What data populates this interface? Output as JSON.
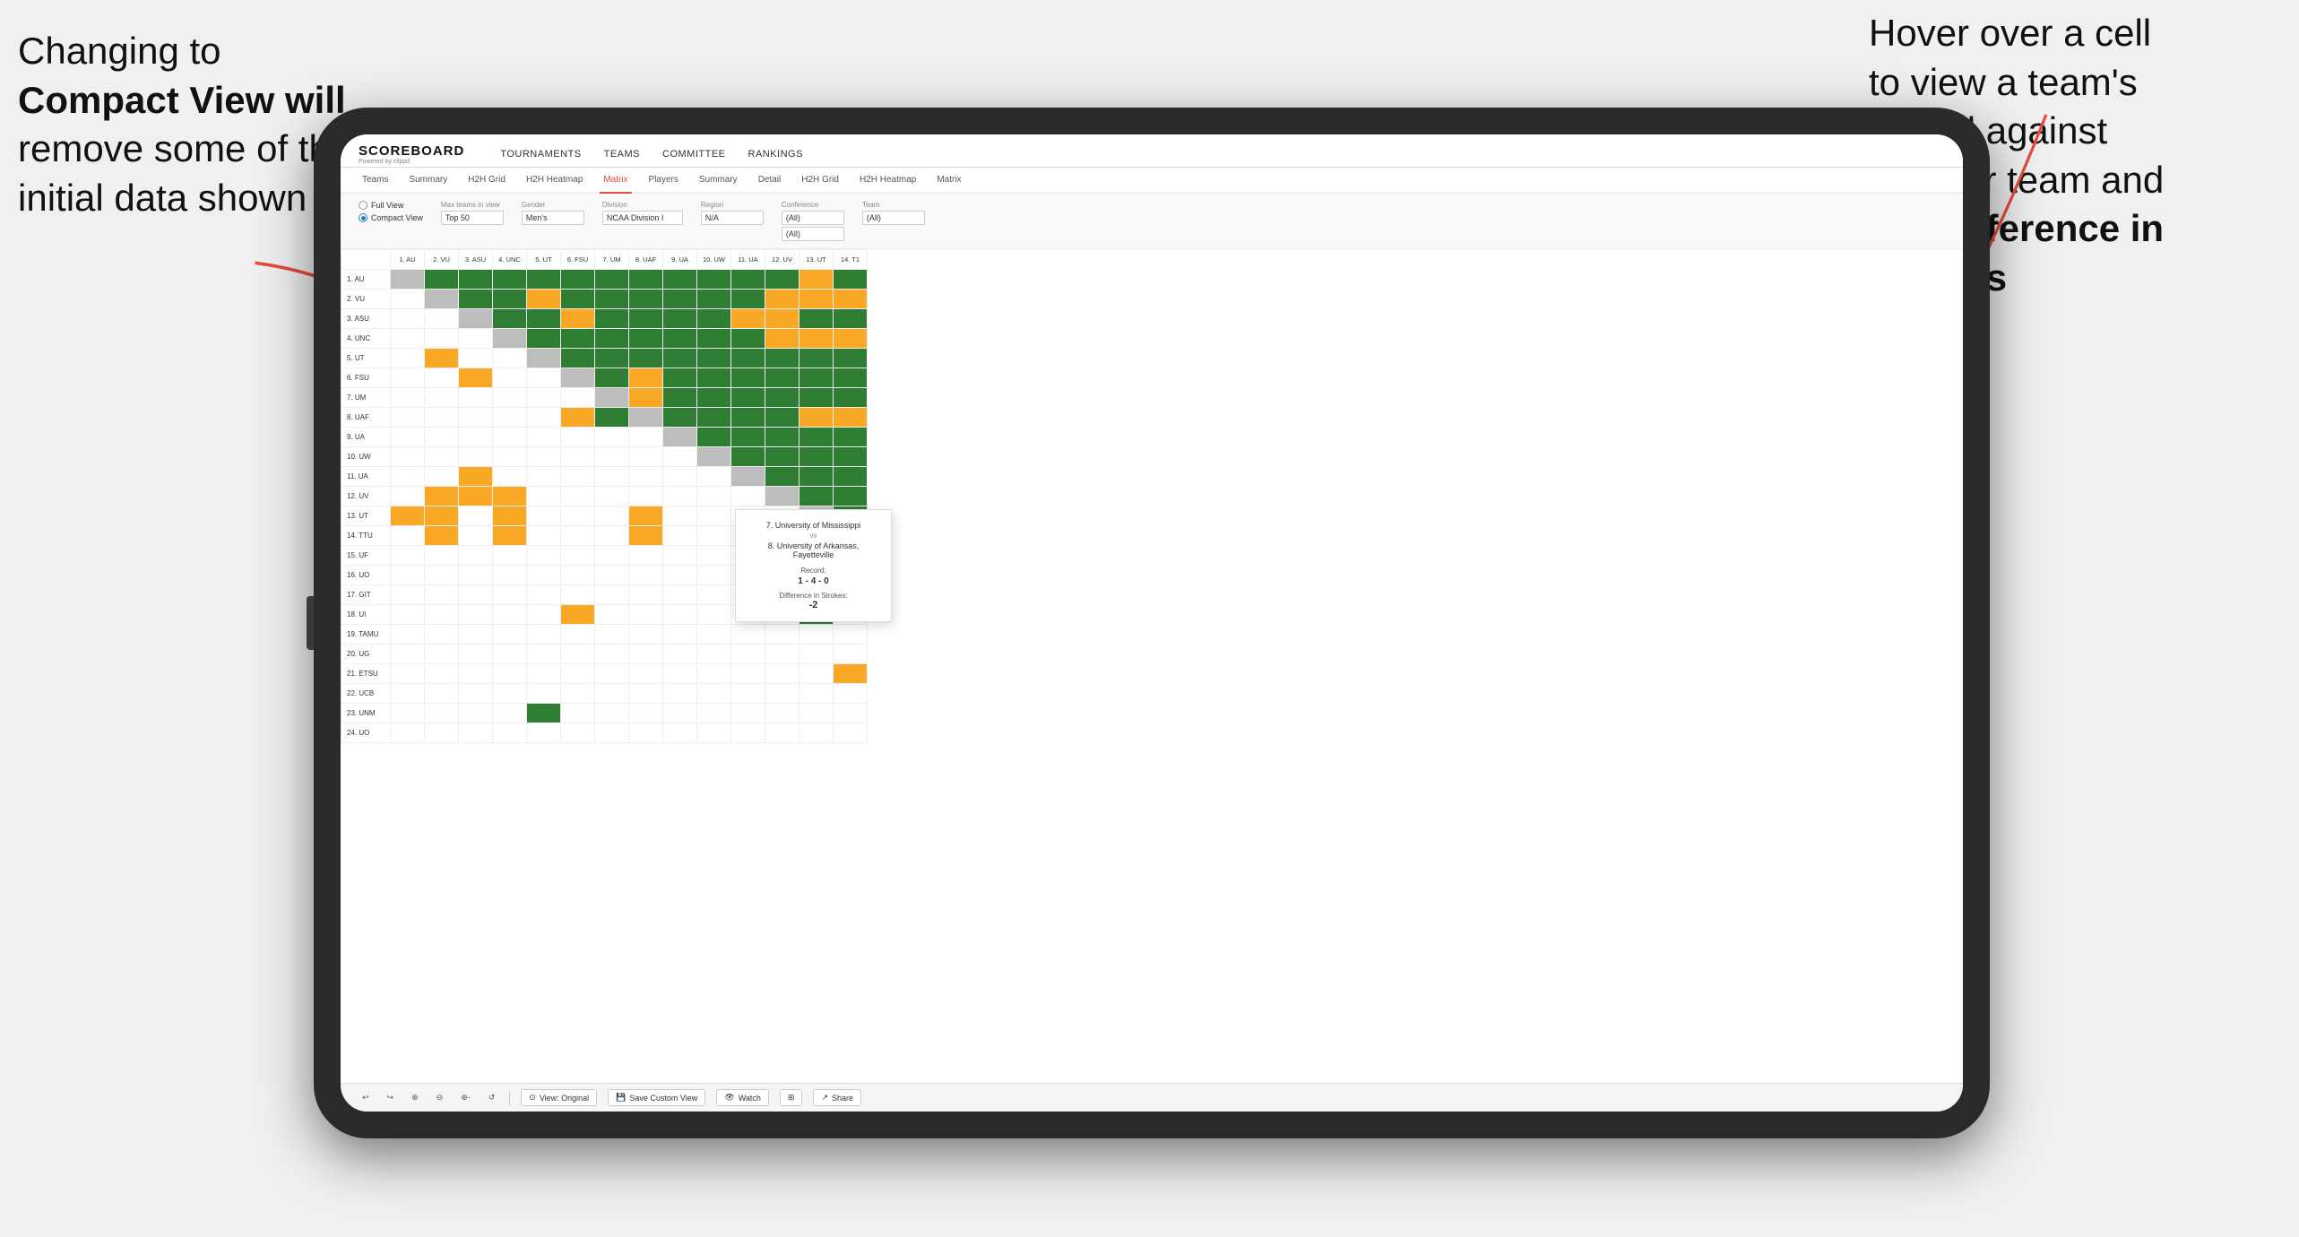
{
  "annotations": {
    "left": {
      "line1": "Changing to",
      "line2bold": "Compact View will",
      "line3": "remove some of the",
      "line4": "initial data shown"
    },
    "right": {
      "line1": "Hover over a cell",
      "line2": "to view a team's",
      "line3": "record against",
      "line4": "another team and",
      "line5bold": "the Difference in",
      "line6bold": "Strokes"
    }
  },
  "scoreboard": {
    "title": "SCOREBOARD",
    "subtitle": "Powered by clippd"
  },
  "nav": {
    "items": [
      "TOURNAMENTS",
      "TEAMS",
      "COMMITTEE",
      "RANKINGS"
    ]
  },
  "subnav": {
    "groups": [
      {
        "label": "Teams",
        "active": false
      },
      {
        "label": "Summary",
        "active": false
      },
      {
        "label": "H2H Grid",
        "active": false
      },
      {
        "label": "H2H Heatmap",
        "active": false
      },
      {
        "label": "Matrix",
        "active": true
      },
      {
        "label": "Players",
        "active": false
      },
      {
        "label": "Summary",
        "active": false
      },
      {
        "label": "Detail",
        "active": false
      },
      {
        "label": "H2H Grid",
        "active": false
      },
      {
        "label": "H2H Heatmap",
        "active": false
      },
      {
        "label": "Matrix",
        "active": false
      }
    ]
  },
  "viewOptions": {
    "fullView": "Full View",
    "compactView": "Compact View",
    "selectedView": "compact"
  },
  "filters": {
    "maxTeams": {
      "label": "Max teams in view",
      "value": "Top 50"
    },
    "gender": {
      "label": "Gender",
      "value": "Men's"
    },
    "division": {
      "label": "Division",
      "value": "NCAA Division I"
    },
    "region": {
      "label": "Region",
      "value": "N/A"
    },
    "conference": {
      "label": "Conference",
      "values": [
        "(All)",
        "(All)",
        "(All)"
      ]
    },
    "team": {
      "label": "Team",
      "value": "(All)"
    }
  },
  "colHeaders": [
    "1. AU",
    "2. VU",
    "3. ASU",
    "4. UNC",
    "5. UT",
    "6. FSU",
    "7. UM",
    "8. UAF",
    "9. UA",
    "10. UW",
    "11. UA",
    "12. UV",
    "13. UT",
    "14. T1"
  ],
  "rows": [
    {
      "label": "1. AU",
      "cells": [
        "x",
        "g",
        "g",
        "g",
        "g",
        "g",
        "g",
        "g",
        "g",
        "g",
        "g",
        "g",
        "y",
        "g"
      ]
    },
    {
      "label": "2. VU",
      "cells": [
        "w",
        "x",
        "g",
        "g",
        "y",
        "g",
        "g",
        "g",
        "g",
        "g",
        "g",
        "y",
        "y",
        "y"
      ]
    },
    {
      "label": "3. ASU",
      "cells": [
        "w",
        "w",
        "x",
        "g",
        "g",
        "y",
        "g",
        "g",
        "g",
        "g",
        "y",
        "y",
        "g",
        "g"
      ]
    },
    {
      "label": "4. UNC",
      "cells": [
        "w",
        "w",
        "w",
        "x",
        "g",
        "g",
        "g",
        "g",
        "g",
        "g",
        "g",
        "y",
        "y",
        "y"
      ]
    },
    {
      "label": "5. UT",
      "cells": [
        "w",
        "y",
        "w",
        "w",
        "x",
        "g",
        "g",
        "g",
        "g",
        "g",
        "g",
        "g",
        "g",
        "g"
      ]
    },
    {
      "label": "6. FSU",
      "cells": [
        "w",
        "w",
        "y",
        "w",
        "w",
        "x",
        "g",
        "y",
        "g",
        "g",
        "g",
        "g",
        "g",
        "g"
      ]
    },
    {
      "label": "7. UM",
      "cells": [
        "w",
        "w",
        "w",
        "w",
        "w",
        "w",
        "x",
        "y",
        "g",
        "g",
        "g",
        "g",
        "g",
        "g"
      ]
    },
    {
      "label": "8. UAF",
      "cells": [
        "w",
        "w",
        "w",
        "w",
        "w",
        "y",
        "g",
        "x",
        "g",
        "g",
        "g",
        "g",
        "y",
        "y"
      ]
    },
    {
      "label": "9. UA",
      "cells": [
        "w",
        "w",
        "w",
        "w",
        "w",
        "w",
        "w",
        "w",
        "x",
        "g",
        "g",
        "g",
        "g",
        "g"
      ]
    },
    {
      "label": "10. UW",
      "cells": [
        "w",
        "w",
        "w",
        "w",
        "w",
        "w",
        "w",
        "w",
        "w",
        "x",
        "g",
        "g",
        "g",
        "g"
      ]
    },
    {
      "label": "11. UA",
      "cells": [
        "w",
        "w",
        "y",
        "w",
        "w",
        "w",
        "w",
        "w",
        "w",
        "w",
        "x",
        "g",
        "g",
        "g"
      ]
    },
    {
      "label": "12. UV",
      "cells": [
        "w",
        "y",
        "y",
        "y",
        "w",
        "w",
        "w",
        "w",
        "w",
        "w",
        "w",
        "x",
        "g",
        "g"
      ]
    },
    {
      "label": "13. UT",
      "cells": [
        "y",
        "y",
        "w",
        "y",
        "w",
        "w",
        "w",
        "y",
        "w",
        "w",
        "w",
        "w",
        "x",
        "g"
      ]
    },
    {
      "label": "14. TTU",
      "cells": [
        "w",
        "y",
        "w",
        "y",
        "w",
        "w",
        "w",
        "y",
        "w",
        "w",
        "w",
        "w",
        "w",
        "x"
      ]
    },
    {
      "label": "15. UF",
      "cells": [
        "w",
        "w",
        "w",
        "w",
        "w",
        "w",
        "w",
        "w",
        "w",
        "w",
        "w",
        "w",
        "w",
        "w"
      ]
    },
    {
      "label": "16. UO",
      "cells": [
        "w",
        "w",
        "w",
        "w",
        "w",
        "w",
        "w",
        "w",
        "w",
        "w",
        "w",
        "w",
        "y",
        "w"
      ]
    },
    {
      "label": "17. GIT",
      "cells": [
        "w",
        "w",
        "w",
        "w",
        "w",
        "w",
        "w",
        "w",
        "w",
        "w",
        "w",
        "y",
        "w",
        "w"
      ]
    },
    {
      "label": "18. UI",
      "cells": [
        "w",
        "w",
        "w",
        "w",
        "w",
        "y",
        "w",
        "w",
        "w",
        "w",
        "w",
        "w",
        "g",
        "w"
      ]
    },
    {
      "label": "19. TAMU",
      "cells": [
        "w",
        "w",
        "w",
        "w",
        "w",
        "w",
        "w",
        "w",
        "w",
        "w",
        "w",
        "w",
        "w",
        "w"
      ]
    },
    {
      "label": "20. UG",
      "cells": [
        "w",
        "w",
        "w",
        "w",
        "w",
        "w",
        "w",
        "w",
        "w",
        "w",
        "w",
        "w",
        "w",
        "w"
      ]
    },
    {
      "label": "21. ETSU",
      "cells": [
        "w",
        "w",
        "w",
        "w",
        "w",
        "w",
        "w",
        "w",
        "w",
        "w",
        "w",
        "w",
        "w",
        "y"
      ]
    },
    {
      "label": "22. UCB",
      "cells": [
        "w",
        "w",
        "w",
        "w",
        "w",
        "w",
        "w",
        "w",
        "w",
        "w",
        "w",
        "w",
        "w",
        "w"
      ]
    },
    {
      "label": "23. UNM",
      "cells": [
        "w",
        "w",
        "w",
        "w",
        "g",
        "w",
        "w",
        "w",
        "w",
        "w",
        "w",
        "w",
        "w",
        "w"
      ]
    },
    {
      "label": "24. UO",
      "cells": [
        "w",
        "w",
        "w",
        "w",
        "w",
        "w",
        "w",
        "w",
        "w",
        "w",
        "w",
        "w",
        "w",
        "w"
      ]
    }
  ],
  "tooltip": {
    "team1": "7. University of Mississippi",
    "vs": "vs",
    "team2": "8. University of Arkansas, Fayetteville",
    "recordLabel": "Record:",
    "recordValue": "1 - 4 - 0",
    "strokesLabel": "Difference in Strokes:",
    "strokesValue": "-2"
  },
  "toolbar": {
    "buttons": [
      "↩",
      "↪",
      "⊕",
      "⊖",
      "⊕-",
      "↺"
    ],
    "viewOriginal": "View: Original",
    "saveCustom": "Save Custom View",
    "watch": "Watch",
    "share": "Share"
  }
}
